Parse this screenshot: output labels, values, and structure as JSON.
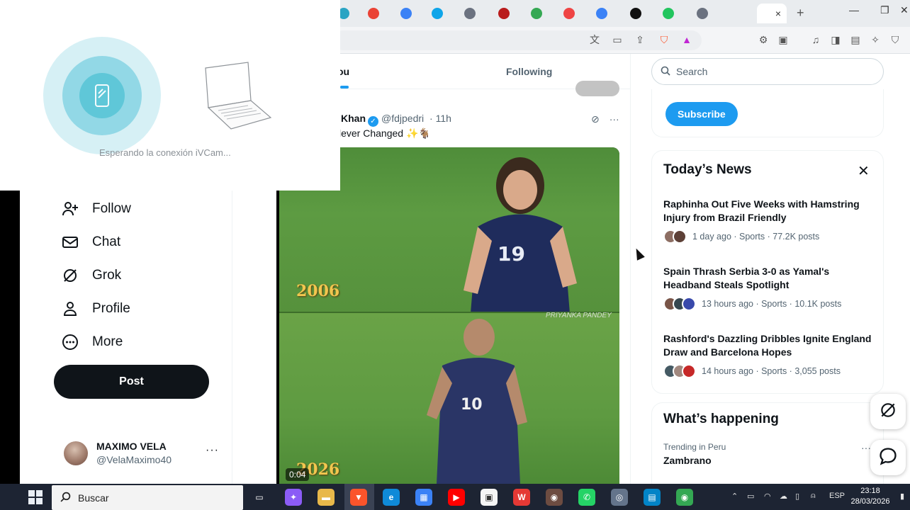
{
  "ivcam": {
    "message": "Esperando la conexión iVCam..."
  },
  "browser": {
    "tabs": [
      {
        "icon": "globe-icon",
        "color": "#2aa4c3"
      },
      {
        "icon": "google-icon",
        "color": "#ea4335"
      },
      {
        "icon": "globe-icon",
        "color": "#3b82f6"
      },
      {
        "icon": "globe-icon",
        "color": "#0ea5e9"
      },
      {
        "icon": "shield-icon",
        "color": "#6b7280"
      },
      {
        "icon": "globe-icon",
        "color": "#b91c1c"
      },
      {
        "icon": "google-icon",
        "color": "#34a853"
      },
      {
        "icon": "youtube-icon",
        "color": "#ef4444"
      },
      {
        "icon": "globe-icon",
        "color": "#3b82f6"
      },
      {
        "icon": "c-icon",
        "color": "#111111"
      },
      {
        "icon": "k-icon",
        "color": "#22c55e"
      },
      {
        "icon": "shield-icon",
        "color": "#6b7280"
      }
    ],
    "active_tab_close": "×",
    "new_tab": "+"
  },
  "x": {
    "tabs": {
      "for_you": "ou",
      "following": "Following"
    },
    "nav": [
      {
        "id": "follow",
        "label": "Follow",
        "icon": "add-person-icon"
      },
      {
        "id": "chat",
        "label": "Chat",
        "icon": "mail-icon"
      },
      {
        "id": "grok",
        "label": "Grok",
        "icon": "grok-icon"
      },
      {
        "id": "profile",
        "label": "Profile",
        "icon": "person-icon"
      },
      {
        "id": "more",
        "label": "More",
        "icon": "more-circle-icon"
      }
    ],
    "post_button": "Post",
    "profile": {
      "name": "MAXIMO VELA",
      "handle": "@VelaMaximo40",
      "more": "···"
    },
    "tweet": {
      "name": "Khan",
      "handle": "@fdjpedri",
      "time": "· 11h",
      "text": "lever Changed ✨🐐",
      "video": {
        "year_top": "2006",
        "year_bottom": "2026",
        "watermark": "PRIYANKA PANDEY",
        "timestamp": "0:04",
        "number_top": "19",
        "number_bottom": "10"
      }
    },
    "search_placeholder": "Search",
    "subscribe_label": "Subscribe",
    "news": {
      "title": "Today’s News",
      "items": [
        {
          "headline": "Raphinha Out Five Weeks with Hamstring Injury from Brazil Friendly",
          "meta": "1 day ago · Sports · 77.2K posts",
          "face_colors": [
            "#8d6e63",
            "#5d4037"
          ]
        },
        {
          "headline": "Spain Thrash Serbia 3-0 as Yamal's Headband Steals Spotlight",
          "meta": "13 hours ago · Sports · 10.1K posts",
          "face_colors": [
            "#795548",
            "#37474f",
            "#3949ab"
          ]
        },
        {
          "headline": "Rashford's Dazzling Dribbles Ignite England Draw and Barcelona Hopes",
          "meta": "14 hours ago · Sports · 3,055 posts",
          "face_colors": [
            "#455a64",
            "#a1887f",
            "#c62828"
          ]
        }
      ]
    },
    "happening": {
      "title": "What’s happening",
      "trend_label": "Trending in Peru",
      "trend_name": "Zambrano",
      "more": "···"
    }
  },
  "taskbar": {
    "search_label": "Buscar",
    "apps": [
      {
        "icon": "task-view-icon",
        "color": "#1d2433",
        "glyph": "▭"
      },
      {
        "icon": "copilot-icon",
        "color": "#8b5cf6",
        "glyph": "✦"
      },
      {
        "icon": "file-explorer-icon",
        "color": "#e8b84a",
        "glyph": "▬"
      },
      {
        "icon": "brave-icon",
        "color": "#fb542b",
        "glyph": "▼"
      },
      {
        "icon": "edge-icon",
        "color": "#0f8ad8",
        "glyph": "e"
      },
      {
        "icon": "store-icon",
        "color": "#3b82f6",
        "glyph": "▦"
      },
      {
        "icon": "youtube-icon",
        "color": "#ff0000",
        "glyph": "▶"
      },
      {
        "icon": "app-icon",
        "color": "#f5f5f5",
        "glyph": "▣"
      },
      {
        "icon": "wps-icon",
        "color": "#e53935",
        "glyph": "W"
      },
      {
        "icon": "app-icon",
        "color": "#6d4c41",
        "glyph": "◉"
      },
      {
        "icon": "whatsapp-icon",
        "color": "#25d366",
        "glyph": "✆"
      },
      {
        "icon": "camera-icon",
        "color": "#64748b",
        "glyph": "◎"
      },
      {
        "icon": "app-icon",
        "color": "#0284c7",
        "glyph": "▤"
      },
      {
        "icon": "chrome-icon",
        "color": "#34a853",
        "glyph": "◉"
      }
    ],
    "lang": "ESP",
    "time": "23:18",
    "date": "28/03/2026"
  }
}
